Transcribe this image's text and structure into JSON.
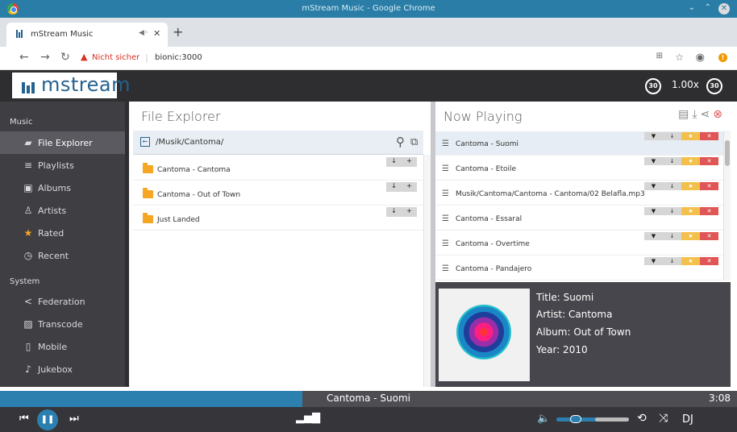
{
  "window": {
    "title": "mStream Music - Google Chrome"
  },
  "browser": {
    "tab_title": "mStream Music",
    "security_label": "Nicht sicher",
    "url": "bionic:3000"
  },
  "app": {
    "brand": "mstream",
    "skip_back": "30",
    "skip_forward": "30",
    "speed": "1.00x",
    "accent": "#2b80b0"
  },
  "sidebar": {
    "section_music": "Music",
    "section_system": "System",
    "music_items": [
      {
        "label": "File Explorer",
        "icon": "folder-icon"
      },
      {
        "label": "Playlists",
        "icon": "playlist-icon"
      },
      {
        "label": "Albums",
        "icon": "album-icon"
      },
      {
        "label": "Artists",
        "icon": "artist-icon"
      },
      {
        "label": "Rated",
        "icon": "star-icon"
      },
      {
        "label": "Recent",
        "icon": "clock-icon"
      }
    ],
    "system_items": [
      {
        "label": "Federation",
        "icon": "share-icon"
      },
      {
        "label": "Transcode",
        "icon": "transcode-icon"
      },
      {
        "label": "Mobile",
        "icon": "mobile-icon"
      },
      {
        "label": "Jukebox",
        "icon": "jukebox-icon"
      }
    ]
  },
  "file_explorer": {
    "title": "File Explorer",
    "path": "/Musik/Cantoma/",
    "folders": [
      "Cantoma - Cantoma",
      "Cantoma - Out of Town",
      "Just Landed"
    ]
  },
  "now_playing": {
    "title": "Now Playing",
    "queue": [
      "Cantoma - Suomi",
      "Cantoma - Etoile",
      "Musik/Cantoma/Cantoma - Cantoma/02 Belafla.mp3",
      "Cantoma - Essaral",
      "Cantoma - Overtime",
      "Cantoma - Pandajero"
    ],
    "selected_index": 0
  },
  "metadata": {
    "title": "Title: Suomi",
    "artist": "Artist: Cantoma",
    "album": "Album: Out of Town",
    "year": "Year: 2010"
  },
  "player": {
    "current_song": "Cantoma - Suomi",
    "time": "3:08",
    "progress": 0.41,
    "volume": 0.3,
    "dj_label": "DJ"
  }
}
